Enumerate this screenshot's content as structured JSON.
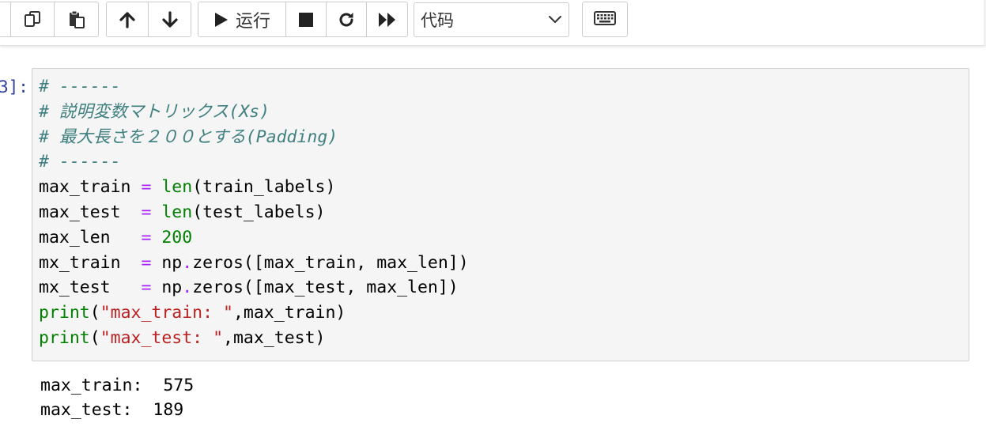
{
  "toolbar": {
    "run_label": "运行",
    "cell_type": {
      "selected": "代码"
    },
    "icons": {
      "copy": "copy-icon",
      "paste": "paste-icon",
      "move_up": "arrow-up-icon",
      "move_down": "arrow-down-icon",
      "run": "play-icon",
      "interrupt": "stop-icon",
      "restart": "restart-icon",
      "restart_run_all": "fast-forward-icon",
      "command_palette": "keyboard-icon",
      "dropdown": "chevron-down-icon"
    }
  },
  "cell": {
    "prompt": "3]:",
    "code_lines": [
      {
        "segments": [
          {
            "t": "cm",
            "v": "# ------"
          }
        ]
      },
      {
        "segments": [
          {
            "t": "cm",
            "v": "# 説明変数マトリックス(Xs)"
          }
        ]
      },
      {
        "segments": [
          {
            "t": "cm",
            "v": "# 最大長さを２００とする(Padding)"
          }
        ]
      },
      {
        "segments": [
          {
            "t": "cm",
            "v": "# ------"
          }
        ]
      },
      {
        "segments": [
          {
            "t": "tx",
            "v": "max_train "
          },
          {
            "t": "op",
            "v": "="
          },
          {
            "t": "tx",
            "v": " "
          },
          {
            "t": "bi",
            "v": "len"
          },
          {
            "t": "tx",
            "v": "(train_labels)"
          }
        ]
      },
      {
        "segments": [
          {
            "t": "tx",
            "v": "max_test  "
          },
          {
            "t": "op",
            "v": "="
          },
          {
            "t": "tx",
            "v": " "
          },
          {
            "t": "bi",
            "v": "len"
          },
          {
            "t": "tx",
            "v": "(test_labels)"
          }
        ]
      },
      {
        "segments": [
          {
            "t": "tx",
            "v": "max_len   "
          },
          {
            "t": "op",
            "v": "="
          },
          {
            "t": "tx",
            "v": " "
          },
          {
            "t": "nm",
            "v": "200"
          }
        ]
      },
      {
        "segments": [
          {
            "t": "tx",
            "v": "mx_train  "
          },
          {
            "t": "op",
            "v": "="
          },
          {
            "t": "tx",
            "v": " np"
          },
          {
            "t": "op",
            "v": "."
          },
          {
            "t": "tx",
            "v": "zeros([max_train, max_len])"
          }
        ]
      },
      {
        "segments": [
          {
            "t": "tx",
            "v": "mx_test   "
          },
          {
            "t": "op",
            "v": "="
          },
          {
            "t": "tx",
            "v": " np"
          },
          {
            "t": "op",
            "v": "."
          },
          {
            "t": "tx",
            "v": "zeros([max_test, max_len])"
          }
        ]
      },
      {
        "segments": [
          {
            "t": "bi",
            "v": "print"
          },
          {
            "t": "tx",
            "v": "("
          },
          {
            "t": "st",
            "v": "\"max_train: \""
          },
          {
            "t": "tx",
            "v": ",max_train)"
          }
        ]
      },
      {
        "segments": [
          {
            "t": "bi",
            "v": "print"
          },
          {
            "t": "tx",
            "v": "("
          },
          {
            "t": "st",
            "v": "\"max_test: \""
          },
          {
            "t": "tx",
            "v": ",max_test)"
          }
        ]
      }
    ],
    "output_lines": [
      "max_train:  575",
      "max_test:  189"
    ]
  },
  "colors": {
    "comment": "#408080",
    "builtin": "#008000",
    "operator": "#aa22ff",
    "number": "#008000",
    "string": "#ba2121",
    "prompt": "#303f9f",
    "cell_bg": "#f5f5f5"
  }
}
